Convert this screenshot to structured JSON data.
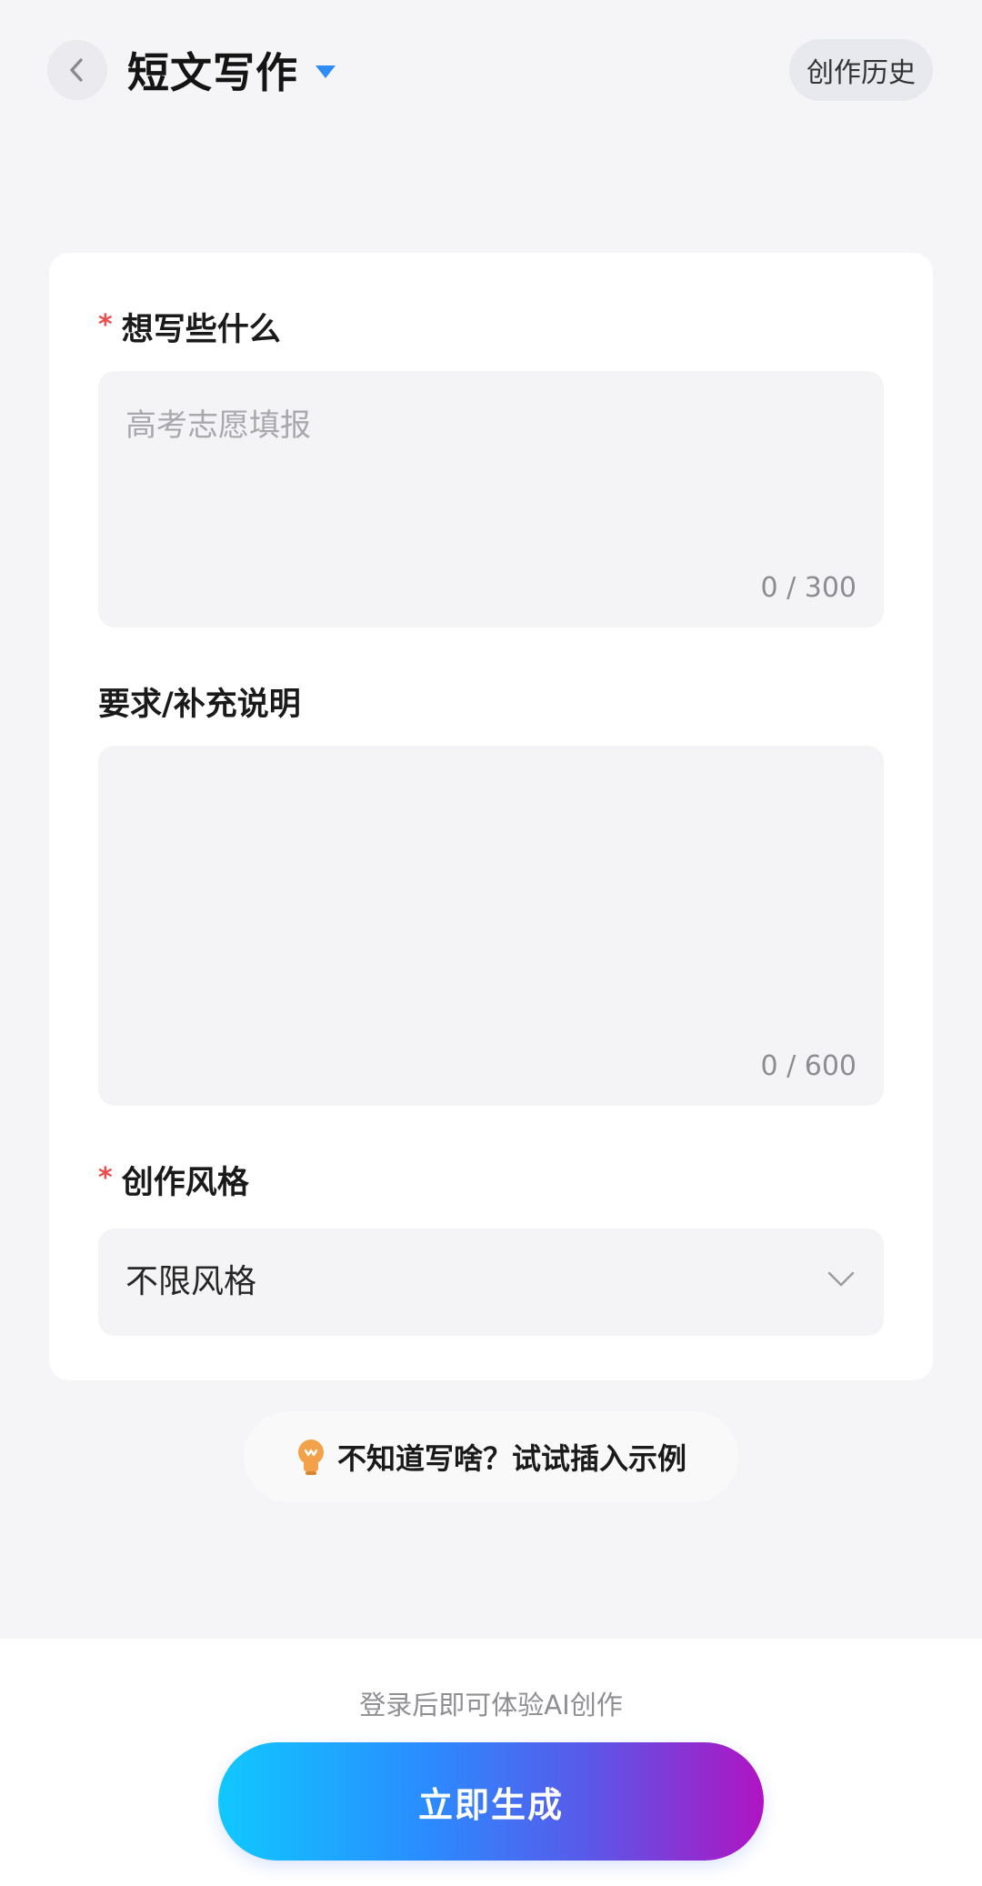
{
  "header": {
    "back_icon": "chevron-left-icon",
    "title": "短文写作",
    "title_caret_icon": "triangle-down-icon",
    "accent_color": "#2f8cf5",
    "history_label": "创作历史"
  },
  "form": {
    "topic": {
      "required_mark": "*",
      "label": "想写些什么",
      "placeholder": "高考志愿填报",
      "value": "",
      "counter": "0 / 300"
    },
    "requirements": {
      "label": "要求/补充说明",
      "value": "",
      "counter": "0 / 600"
    },
    "style": {
      "required_mark": "*",
      "label": "创作风格",
      "selected": "不限风格",
      "chevron_icon": "chevron-down-icon"
    }
  },
  "example": {
    "icon": "lightbulb-icon",
    "label": "不知道写啥？试试插入示例"
  },
  "footer": {
    "login_hint": "登录后即可体验AI创作",
    "generate_label": "立即生成"
  },
  "colors": {
    "required": "#ef4b4b",
    "gradient_start": "#10c8ff",
    "gradient_end": "#b014c2"
  }
}
